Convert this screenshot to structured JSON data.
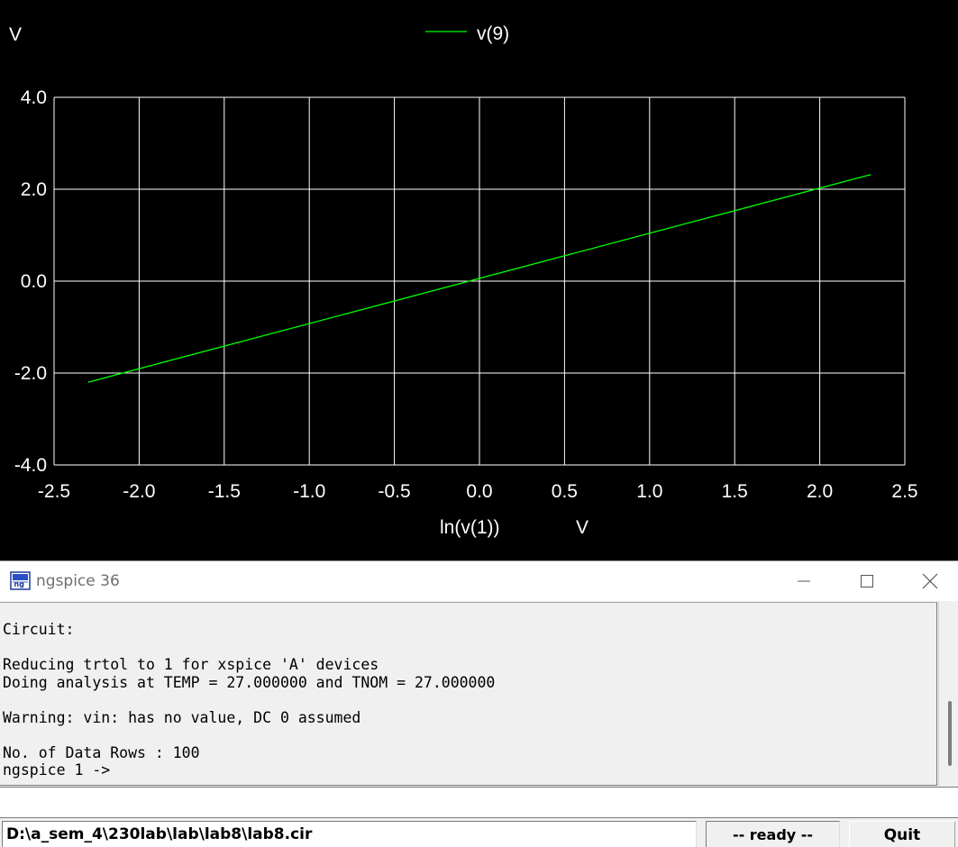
{
  "chart_data": {
    "type": "line",
    "title": "",
    "ylabel": "V",
    "xlabel": "ln(v(1))",
    "xunit": "V",
    "xlim": [
      -2.5,
      2.5
    ],
    "ylim": [
      -4.0,
      4.0
    ],
    "xticks": [
      "-2.5",
      "-2.0",
      "-1.5",
      "-1.0",
      "-0.5",
      "0.0",
      "0.5",
      "1.0",
      "1.5",
      "2.0",
      "2.5"
    ],
    "yticks": [
      "4.0",
      "2.0",
      "0.0",
      "-2.0",
      "-4.0"
    ],
    "grid": true,
    "legend_position": "top-center",
    "background": "#000000",
    "grid_color": "#ffffff",
    "series": [
      {
        "name": "v(9)",
        "color": "#00ff00",
        "x": [
          -2.3,
          2.3
        ],
        "y": [
          -2.2,
          2.32
        ]
      }
    ]
  },
  "window": {
    "title": "ngspice 36",
    "icon": "ngspice-app-icon",
    "minimize_icon": "minimize-icon",
    "maximize_icon": "maximize-icon",
    "close_icon": "close-icon"
  },
  "console": {
    "lines": [
      "Circuit:",
      "",
      "Reducing trtol to 1 for xspice 'A' devices",
      "Doing analysis at TEMP = 27.000000 and TNOM = 27.000000",
      "",
      "Warning: vin: has no value, DC 0 assumed",
      "",
      "No. of Data Rows : 100",
      "ngspice 1 ->"
    ],
    "command_value": ""
  },
  "status": {
    "path": "D:\\a_sem_4\\230lab\\lab\\lab8\\lab8.cir",
    "state": "-- ready --",
    "quit_label": "Quit"
  }
}
